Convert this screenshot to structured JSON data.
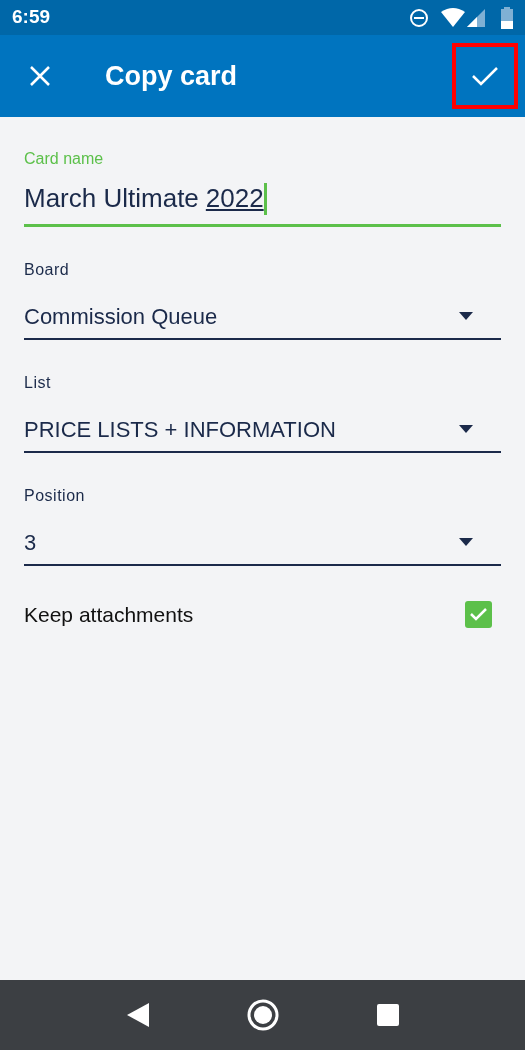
{
  "status_bar": {
    "time": "6:59"
  },
  "app_bar": {
    "title": "Copy card",
    "confirm_highlighted": true
  },
  "card_name": {
    "label": "Card name",
    "value": "March Ultimate",
    "composing": "2022",
    "focused": true
  },
  "dropdowns": [
    {
      "label": "Board",
      "value": "Commission Queue"
    },
    {
      "label": "List",
      "value": "PRICE LISTS + INFORMATION"
    },
    {
      "label": "Position",
      "value": "3"
    }
  ],
  "keep_attachments": {
    "label": "Keep attachments",
    "checked": true
  }
}
